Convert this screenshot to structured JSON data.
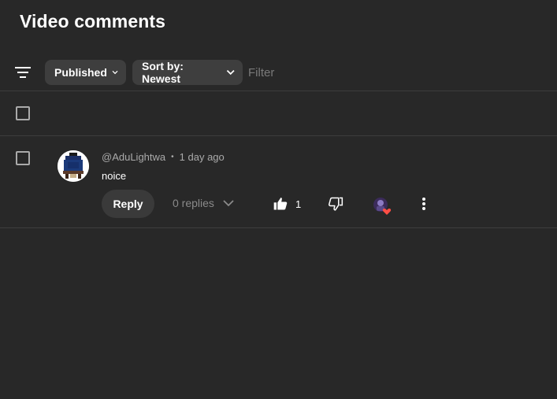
{
  "page": {
    "title": "Video comments"
  },
  "filters": {
    "filter_icon": "filter-lines-icon",
    "published_label": "Published",
    "sort_label": "Sort by: Newest",
    "filter_placeholder": "Filter",
    "chevron_icon": "chevron-down-icon"
  },
  "comments": [
    {
      "author": "@AduLightwa",
      "separator": "•",
      "time": "1 day ago",
      "text": "noice",
      "reply_label": "Reply",
      "replies_label": "0 replies",
      "like_count": "1",
      "icons": {
        "like": "thumbs-up-icon",
        "dislike": "thumbs-down-icon",
        "heart": "creator-heart-icon",
        "more": "more-vertical-icon"
      }
    }
  ],
  "colors": {
    "background": "#282828",
    "chip": "#3e3e3e",
    "divider": "#3d3d3d",
    "muted_text": "#aaaaaa",
    "heart": "#ff4e45"
  }
}
